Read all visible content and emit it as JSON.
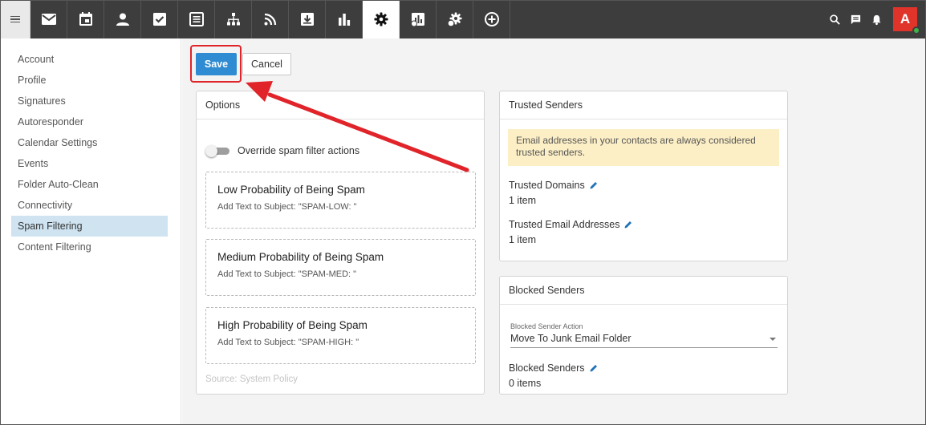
{
  "topbar": {
    "apps": [
      {
        "icon": "mail-icon"
      },
      {
        "icon": "calendar-icon"
      },
      {
        "icon": "contacts-icon"
      },
      {
        "icon": "tasks-icon"
      },
      {
        "icon": "notes-icon"
      },
      {
        "icon": "sitemap-icon"
      },
      {
        "icon": "rss-icon"
      },
      {
        "icon": "download-icon"
      },
      {
        "icon": "bar-chart-icon"
      },
      {
        "icon": "settings-gear-icon",
        "active": true
      },
      {
        "icon": "domain-reports-icon"
      },
      {
        "icon": "domain-settings-icon"
      },
      {
        "icon": "add-circle-icon"
      }
    ],
    "avatar_letter": "A",
    "colors": {
      "bar": "#3d3d3d",
      "avatar": "#e0342b",
      "presence": "#3cb44b"
    }
  },
  "sidebar": {
    "items": [
      {
        "label": "Account"
      },
      {
        "label": "Profile"
      },
      {
        "label": "Signatures"
      },
      {
        "label": "Autoresponder"
      },
      {
        "label": "Calendar Settings"
      },
      {
        "label": "Events"
      },
      {
        "label": "Folder Auto-Clean"
      },
      {
        "label": "Connectivity"
      },
      {
        "label": "Spam Filtering",
        "selected": true
      },
      {
        "label": "Content Filtering"
      }
    ]
  },
  "toolbar": {
    "save_label": "Save",
    "cancel_label": "Cancel"
  },
  "options": {
    "title": "Options",
    "override_label": "Override spam filter actions",
    "override_enabled": false,
    "boxes": [
      {
        "title": "Low Probability of Being Spam",
        "subtitle": "Add Text to Subject: \"SPAM-LOW: \""
      },
      {
        "title": "Medium Probability of Being Spam",
        "subtitle": "Add Text to Subject: \"SPAM-MED: \""
      },
      {
        "title": "High Probability of Being Spam",
        "subtitle": "Add Text to Subject: \"SPAM-HIGH: \""
      }
    ],
    "source": "Source: System Policy"
  },
  "trusted": {
    "title": "Trusted Senders",
    "notice": "Email addresses in your contacts are always considered trusted senders.",
    "domains_label": "Trusted Domains",
    "domains_value": "1 item",
    "emails_label": "Trusted Email Addresses",
    "emails_value": "1 item"
  },
  "blocked": {
    "title": "Blocked Senders",
    "action_caption": "Blocked Sender Action",
    "action_value": "Move To Junk Email Folder",
    "senders_label": "Blocked Senders",
    "senders_value": "0 items"
  },
  "annotation": {
    "color": "#e0242a"
  }
}
